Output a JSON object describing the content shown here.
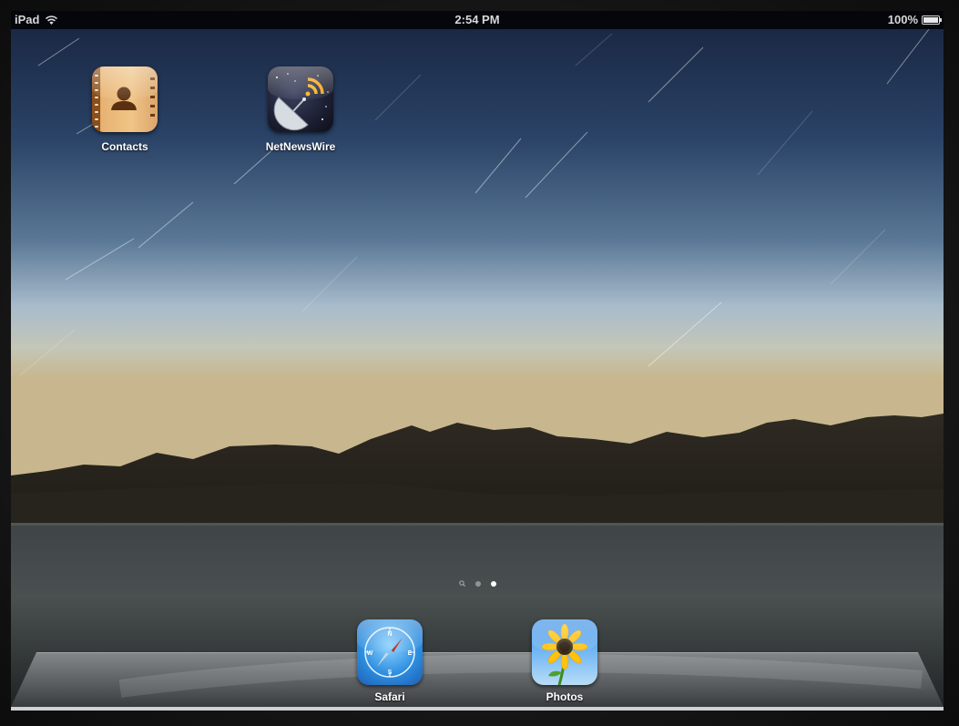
{
  "status_bar": {
    "carrier": "iPad",
    "time": "2:54 PM",
    "battery": "100%",
    "battery_level": 1.0
  },
  "home_apps": [
    {
      "label": "Contacts",
      "icon": "contacts-icon"
    },
    {
      "label": "NetNewsWire",
      "icon": "netnewswire-icon"
    }
  ],
  "page_indicator": {
    "pages": 2,
    "current_page": 2,
    "has_search_page": true
  },
  "dock_apps": [
    {
      "label": "Safari",
      "icon": "safari-icon"
    },
    {
      "label": "Photos",
      "icon": "photos-icon"
    }
  ],
  "colors": {
    "sky_top": "#1a2a47",
    "sky_horizon": "#a9bccd",
    "mountains": "#2e2a22",
    "water": "#3a3f40"
  }
}
